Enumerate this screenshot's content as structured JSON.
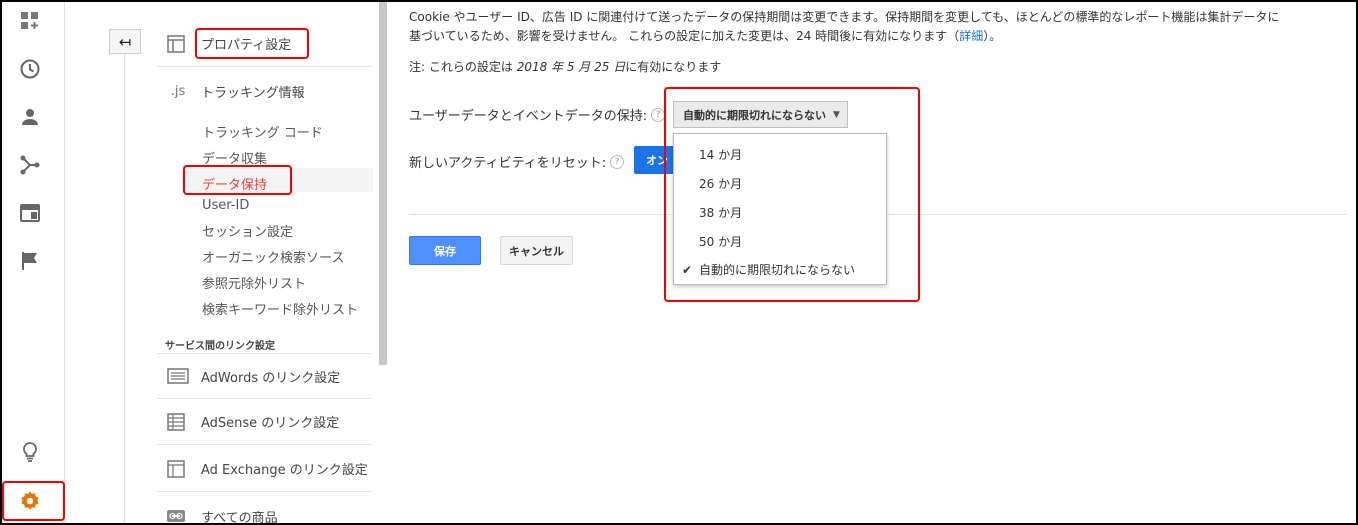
{
  "rail": {
    "icons": [
      "dashboard-icon",
      "clock-icon",
      "person-icon",
      "fork-icon",
      "window-icon",
      "flag-icon",
      "bulb-icon",
      "gear-icon"
    ],
    "accent": "#e37400"
  },
  "back_button": {
    "label": "↤"
  },
  "sidebar": {
    "property_settings": "プロパティ設定",
    "tracking_info": "トラッキング情報",
    "tracking_info_icon": ".js",
    "sub_items": [
      "トラッキング コード",
      "データ収集",
      "データ保持",
      "User-ID",
      "セッション設定",
      "オーガニック検索ソース",
      "参照元除外リスト",
      "検索キーワード除外リスト"
    ],
    "active_index": 2,
    "section_label": "サービス間のリンク設定",
    "links": [
      "AdWords のリンク設定",
      "AdSense のリンク設定",
      "Ad Exchange のリンク設定",
      "すべての商品"
    ]
  },
  "main": {
    "description_1": "Cookie やユーザー ID、広告 ID に関連付けて送ったデータの保持期間は変更できます。保持期間を変更しても、ほとんどの標準的なレポート機能は集計データに",
    "description_2": "基づいているため、影響を受けません。 これらの設定に加えた変更は、24 時間後に有効になります（",
    "details_link": "詳細",
    "description_end": "）。",
    "note_prefix": "注: これらの設定は ",
    "note_date": "2018 年 5 月 25 日",
    "note_suffix": "に有効になります",
    "retention_label": "ユーザーデータとイベントデータの保持:",
    "retention_value": "自動的に期限切れにならない",
    "reset_label": "新しいアクティビティをリセット:",
    "reset_toggle": "オン",
    "help": "?",
    "save": "保存",
    "cancel": "キャンセル"
  },
  "dropdown": {
    "options": [
      "14 か月",
      "26 か月",
      "38 か月",
      "50 か月",
      "自動的に期限切れにならない"
    ],
    "selected_index": 4
  }
}
